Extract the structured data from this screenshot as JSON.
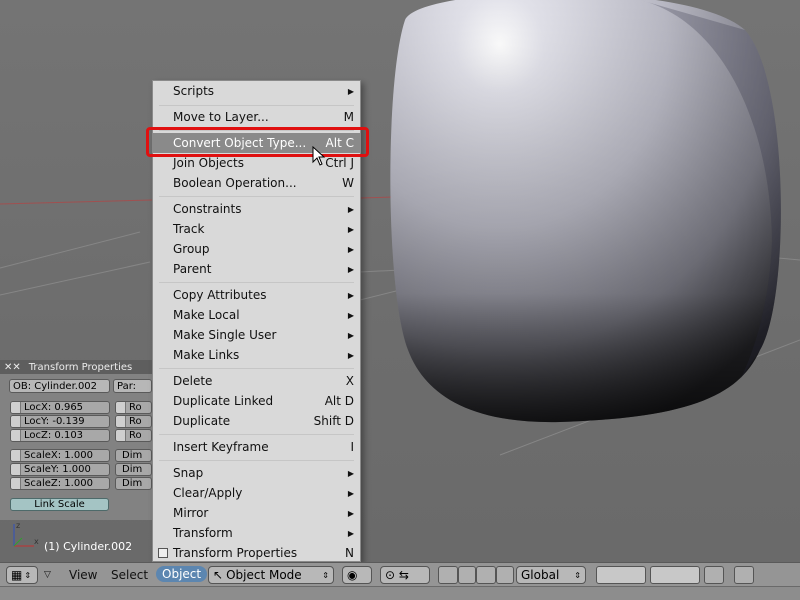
{
  "menu": {
    "items": [
      {
        "label": "Scripts",
        "shortcut": "",
        "submenu": true
      },
      {
        "label": "Move to Layer...",
        "shortcut": "M",
        "submenu": false
      },
      {
        "label": "Convert Object Type...",
        "shortcut": "Alt C",
        "submenu": false,
        "highlighted": true
      },
      {
        "label": "Join Objects",
        "shortcut": "Ctrl J",
        "submenu": false
      },
      {
        "label": "Boolean Operation...",
        "shortcut": "W",
        "submenu": false
      },
      {
        "label": "Constraints",
        "shortcut": "",
        "submenu": true
      },
      {
        "label": "Track",
        "shortcut": "",
        "submenu": true
      },
      {
        "label": "Group",
        "shortcut": "",
        "submenu": true
      },
      {
        "label": "Parent",
        "shortcut": "",
        "submenu": true
      },
      {
        "label": "Copy Attributes",
        "shortcut": "",
        "submenu": true
      },
      {
        "label": "Make Local",
        "shortcut": "",
        "submenu": true
      },
      {
        "label": "Make Single User",
        "shortcut": "",
        "submenu": true
      },
      {
        "label": "Make Links",
        "shortcut": "",
        "submenu": true
      },
      {
        "label": "Delete",
        "shortcut": "X",
        "submenu": false
      },
      {
        "label": "Duplicate Linked",
        "shortcut": "Alt D",
        "submenu": false
      },
      {
        "label": "Duplicate",
        "shortcut": "Shift D",
        "submenu": false
      },
      {
        "label": "Insert Keyframe",
        "shortcut": "I",
        "submenu": false
      },
      {
        "label": "Snap",
        "shortcut": "",
        "submenu": true
      },
      {
        "label": "Clear/Apply",
        "shortcut": "",
        "submenu": true
      },
      {
        "label": "Mirror",
        "shortcut": "",
        "submenu": true
      },
      {
        "label": "Transform",
        "shortcut": "",
        "submenu": true
      },
      {
        "label": "Transform Properties",
        "shortcut": "N",
        "submenu": false,
        "checkbox": true
      }
    ]
  },
  "transform_panel": {
    "title": "Transform Properties",
    "ob_name": "OB: Cylinder.002",
    "par_label": "Par:",
    "loc_x": "LocX: 0.965",
    "loc_y": "LocY: -0.139",
    "loc_z": "LocZ: 0.103",
    "scale_x": "ScaleX: 1.000",
    "scale_y": "ScaleY: 1.000",
    "scale_z": "ScaleZ: 1.000",
    "rot_stub": "Ro",
    "dim_stub": "Dim",
    "link_scale": "Link Scale"
  },
  "viewport": {
    "object_label": "(1) Cylinder.002"
  },
  "header": {
    "view": "View",
    "select": "Select",
    "object": "Object",
    "mode": "Object Mode",
    "orientation": "Global"
  },
  "colors": {
    "highlight_box": "#e01010",
    "menu_bg": "#d9d9d9",
    "menu_highlight": "#8a8a8a",
    "header_bg": "#959595"
  }
}
